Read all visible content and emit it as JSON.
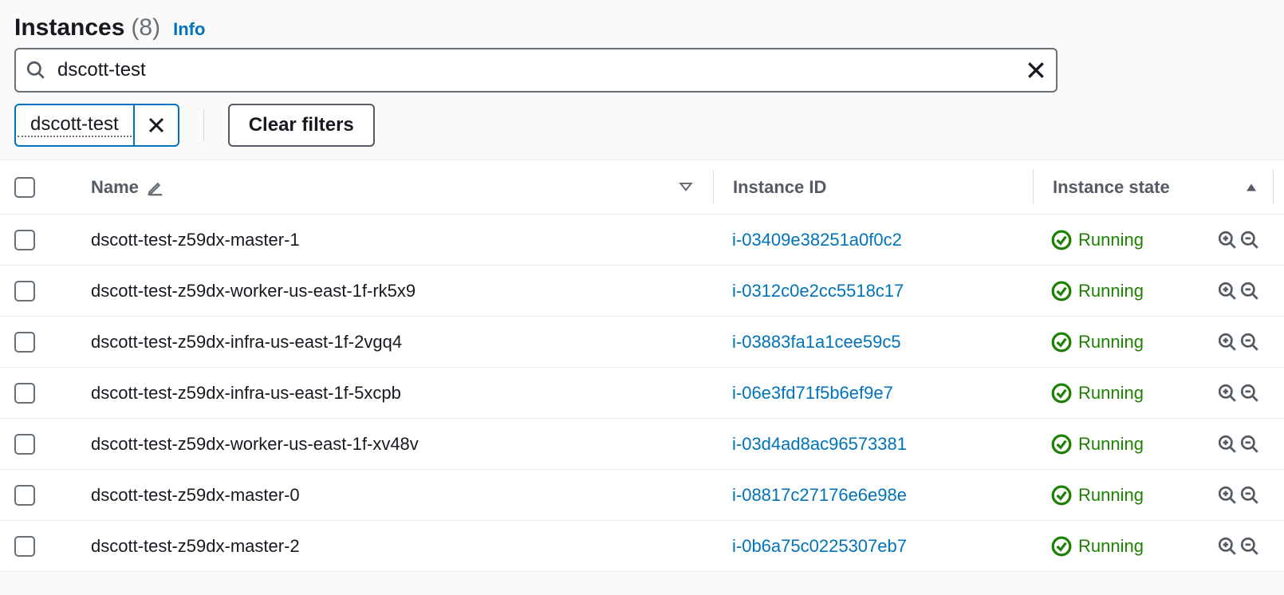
{
  "header": {
    "title": "Instances",
    "count": "(8)",
    "info_label": "Info"
  },
  "search": {
    "value": "dscott-test"
  },
  "filter_tag": {
    "label": "dscott-test"
  },
  "clear_filters_label": "Clear filters",
  "columns": {
    "name": "Name",
    "instance_id": "Instance ID",
    "instance_state": "Instance state"
  },
  "rows": [
    {
      "name": "dscott-test-z59dx-master-1",
      "id": "i-03409e38251a0f0c2",
      "state": "Running"
    },
    {
      "name": "dscott-test-z59dx-worker-us-east-1f-rk5x9",
      "id": "i-0312c0e2cc5518c17",
      "state": "Running"
    },
    {
      "name": "dscott-test-z59dx-infra-us-east-1f-2vgq4",
      "id": "i-03883fa1a1cee59c5",
      "state": "Running"
    },
    {
      "name": "dscott-test-z59dx-infra-us-east-1f-5xcpb",
      "id": "i-06e3fd71f5b6ef9e7",
      "state": "Running"
    },
    {
      "name": "dscott-test-z59dx-worker-us-east-1f-xv48v",
      "id": "i-03d4ad8ac96573381",
      "state": "Running"
    },
    {
      "name": "dscott-test-z59dx-master-0",
      "id": "i-08817c27176e6e98e",
      "state": "Running"
    },
    {
      "name": "dscott-test-z59dx-master-2",
      "id": "i-0b6a75c0225307eb7",
      "state": "Running"
    }
  ]
}
